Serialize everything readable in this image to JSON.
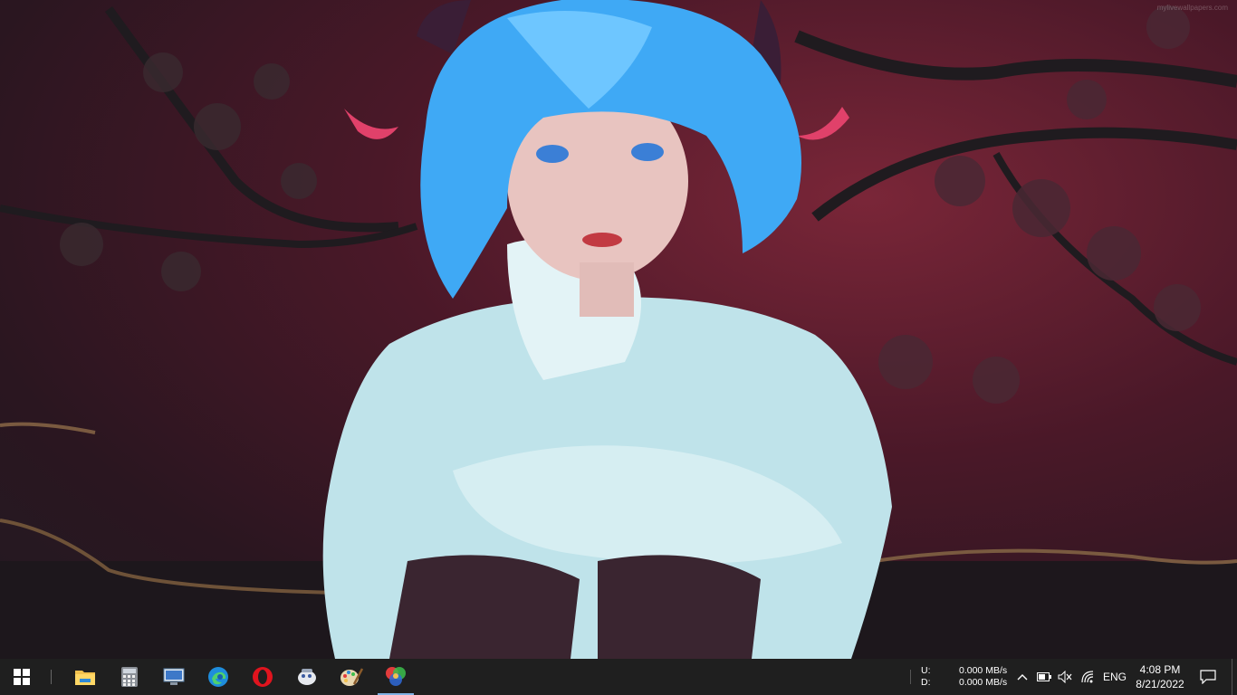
{
  "desktop": {
    "wallpaper": "anime-girl-blue-hair-cherry-blossom",
    "watermark": "mylivewallpapers.com",
    "colors": {
      "bg_dark": "#2a1620",
      "bg_red": "#7a2638",
      "hair": "#3fa9f5",
      "sweater": "#cfe9ee"
    }
  },
  "taskbar": {
    "start_icon": "windows-logo-icon",
    "pinned": [
      {
        "name": "file-explorer-icon"
      },
      {
        "name": "calculator-icon"
      },
      {
        "name": "remote-desktop-icon"
      },
      {
        "name": "edge-browser-icon"
      },
      {
        "name": "opera-browser-icon"
      },
      {
        "name": "app-icon"
      },
      {
        "name": "paint-icon"
      },
      {
        "name": "color-wheel-icon",
        "active": true
      }
    ],
    "network_meter": {
      "upload_label": "U:",
      "upload_value": "0.000 MB/s",
      "download_label": "D:",
      "download_value": "0.000 MB/s"
    },
    "tray": {
      "chevron_icon": "chevron-up-icon",
      "battery_icon": "battery-icon",
      "volume_icon": "volume-muted-icon",
      "wifi_icon": "wifi-icon",
      "language": "ENG"
    },
    "clock": {
      "time": "4:08 PM",
      "date": "8/21/2022"
    },
    "notification_icon": "action-center-icon",
    "accent": "#7fb2e5"
  }
}
